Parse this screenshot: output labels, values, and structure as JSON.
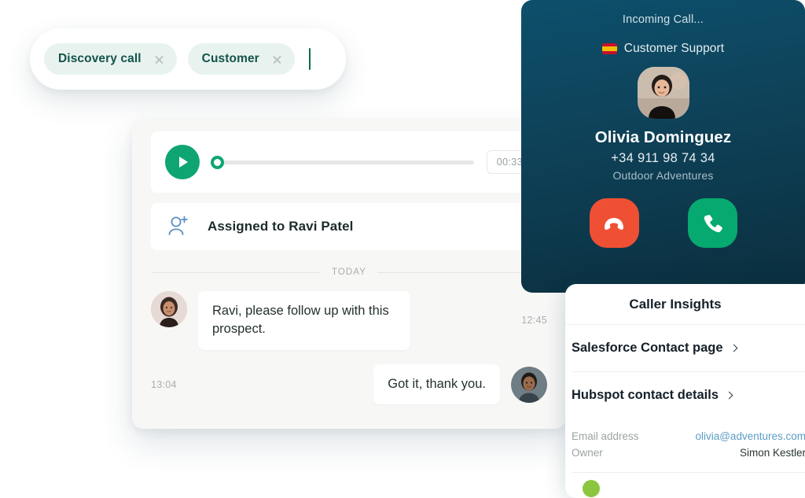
{
  "tag_input": {
    "tags": [
      {
        "label": "Discovery call",
        "remove_icon": "close-icon"
      },
      {
        "label": "Customer",
        "remove_icon": "close-icon"
      }
    ]
  },
  "conversation": {
    "player": {
      "play_icon": "play-icon",
      "duration": "00:33",
      "progress_percent": 0
    },
    "assignment": {
      "icon": "add-person-icon",
      "label": "Assigned to Ravi Patel",
      "chevron_icon": "chevron-right-icon"
    },
    "date_separator": "TODAY",
    "messages": [
      {
        "side": "left",
        "text": "Ravi, please follow up with this prospect.",
        "time": "12:45",
        "avatar": "avatar-sender"
      },
      {
        "side": "right",
        "text": "Got it, thank you.",
        "time": "13:04",
        "avatar": "avatar-recipient"
      }
    ]
  },
  "incoming_call": {
    "status": "Incoming Call...",
    "flag_icon": "spain-flag-icon",
    "queue": "Customer Support",
    "caller_name": "Olivia Dominguez",
    "caller_phone": "+34 911 98 74 34",
    "caller_company": "Outdoor Adventures",
    "decline_icon": "hangup-icon",
    "accept_icon": "phone-icon",
    "panel_gradient_top": "#0d4f6b",
    "panel_gradient_bottom": "#0b2f3e",
    "decline_color": "#ef5033",
    "accept_color": "#06a96f"
  },
  "caller_insights": {
    "title": "Caller Insights",
    "links": [
      {
        "label": "Salesforce Contact page",
        "chevron_icon": "chevron-right-icon"
      },
      {
        "label": "Hubspot contact details",
        "chevron_icon": "chevron-right-icon"
      }
    ],
    "fields": [
      {
        "key": "Email address",
        "value": "olivia@adventures.com",
        "is_link": true
      },
      {
        "key": "Owner",
        "value": "Simon Kestler",
        "is_link": false
      }
    ]
  },
  "theme": {
    "accent_green": "#0fa572",
    "tag_bg": "#e8f3ef",
    "tag_text": "#14534a",
    "link_blue": "#5b9cc4"
  }
}
